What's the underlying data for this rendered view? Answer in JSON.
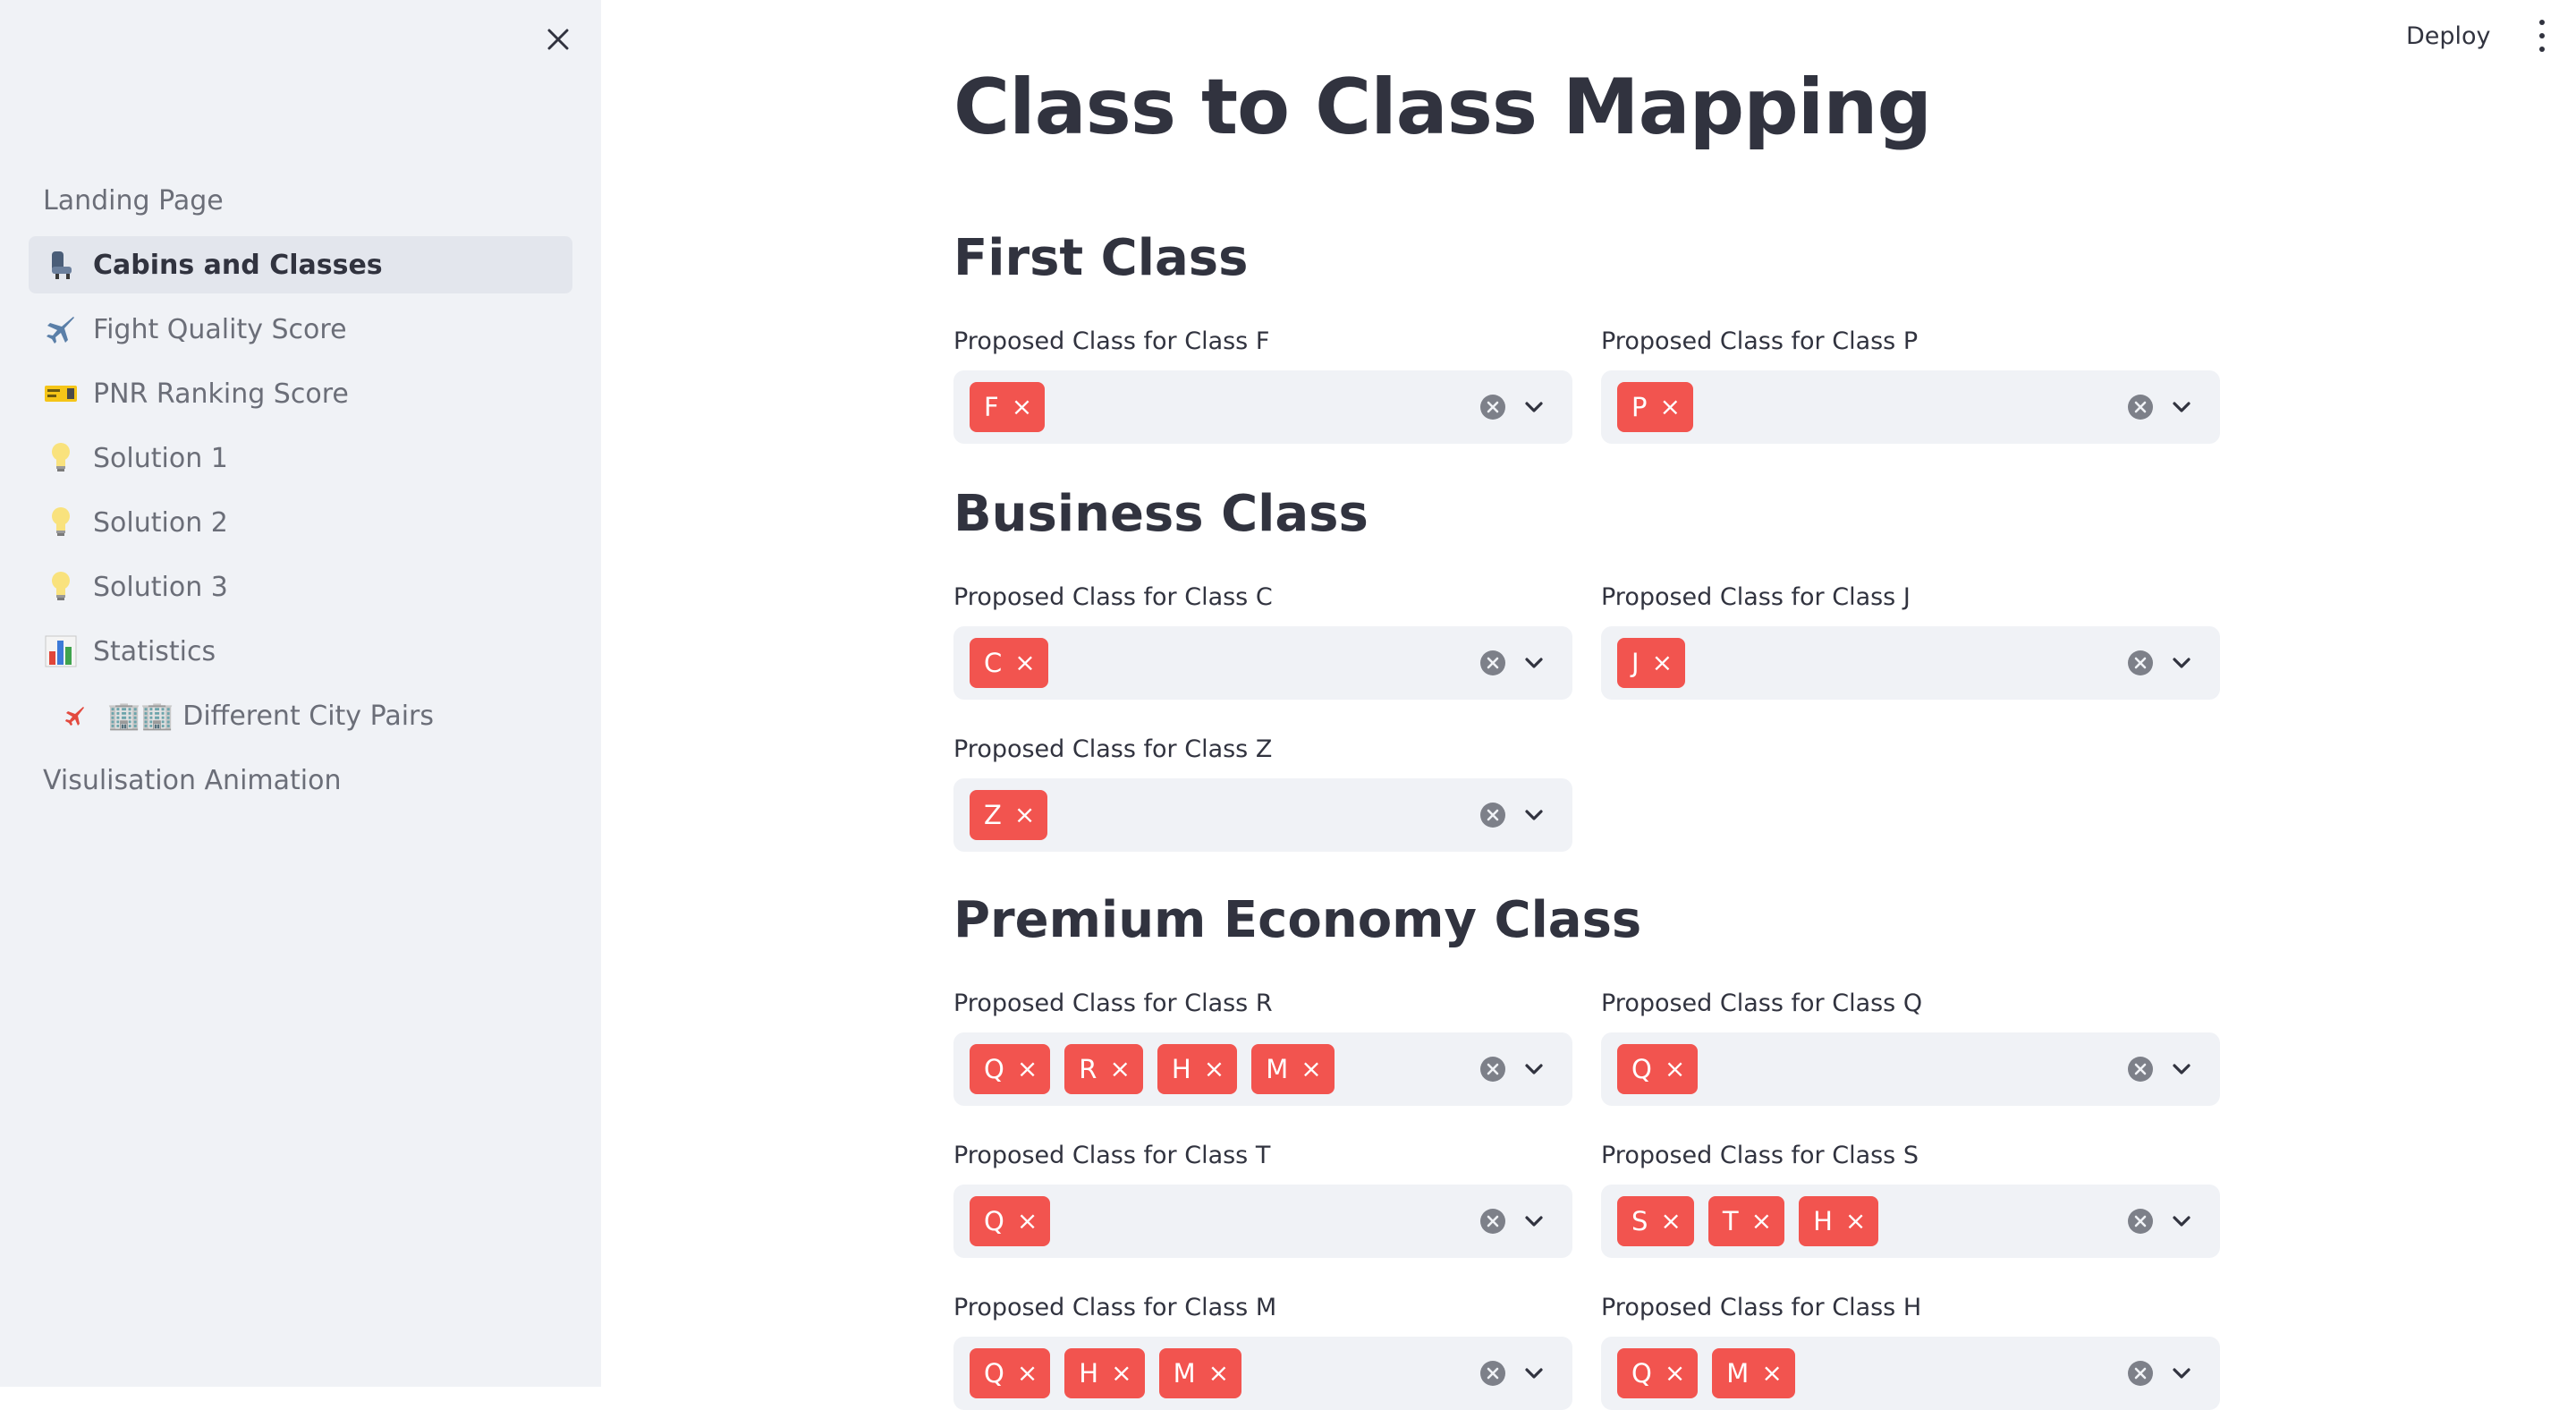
{
  "header": {
    "deploy_label": "Deploy"
  },
  "sidebar": {
    "items": [
      {
        "label": "Landing Page",
        "icon": "",
        "active": false
      },
      {
        "label": "Cabins and Classes",
        "icon": "seat-icon",
        "active": true
      },
      {
        "label": "Fight Quality Score",
        "icon": "airplane-icon",
        "active": false
      },
      {
        "label": "PNR Ranking Score",
        "icon": "ticket-icon",
        "active": false
      },
      {
        "label": "Solution 1",
        "icon": "lightbulb-icon",
        "active": false
      },
      {
        "label": "Solution 2",
        "icon": "lightbulb-icon",
        "active": false
      },
      {
        "label": "Solution 3",
        "icon": "lightbulb-icon",
        "active": false
      },
      {
        "label": "Statistics",
        "icon": "bar-chart-icon",
        "active": false
      },
      {
        "label": "🏢🏢 Different City Pairs",
        "icon": "small-airplane-icon",
        "active": false
      },
      {
        "label": "Visulisation Animation",
        "icon": "",
        "active": false
      }
    ]
  },
  "main": {
    "title": "Class to Class Mapping",
    "sections": [
      {
        "heading": "First Class"
      },
      {
        "heading": "Business Class"
      },
      {
        "heading": "Premium Economy Class"
      }
    ],
    "fields": [
      {
        "label": "Proposed Class for Class F",
        "chips": [
          "F"
        ]
      },
      {
        "label": "Proposed Class for Class P",
        "chips": [
          "P"
        ]
      },
      {
        "label": "Proposed Class for Class C",
        "chips": [
          "C"
        ]
      },
      {
        "label": "Proposed Class for Class J",
        "chips": [
          "J"
        ]
      },
      {
        "label": "Proposed Class for Class Z",
        "chips": [
          "Z"
        ]
      },
      {
        "label": "Proposed Class for Class R",
        "chips": [
          "Q",
          "R",
          "H",
          "M"
        ]
      },
      {
        "label": "Proposed Class for Class Q",
        "chips": [
          "Q"
        ]
      },
      {
        "label": "Proposed Class for Class T",
        "chips": [
          "Q"
        ]
      },
      {
        "label": "Proposed Class for Class S",
        "chips": [
          "S",
          "T",
          "H"
        ]
      },
      {
        "label": "Proposed Class for Class M",
        "chips": [
          "Q",
          "H",
          "M"
        ]
      },
      {
        "label": "Proposed Class for Class H",
        "chips": [
          "Q",
          "M"
        ]
      }
    ],
    "chip_remove_glyph": "×"
  },
  "colors": {
    "sidebar_bg": "#f0f2f6",
    "chip_bg": "#f2544f",
    "text": "#31333f",
    "muted_text": "#6b6e78"
  }
}
